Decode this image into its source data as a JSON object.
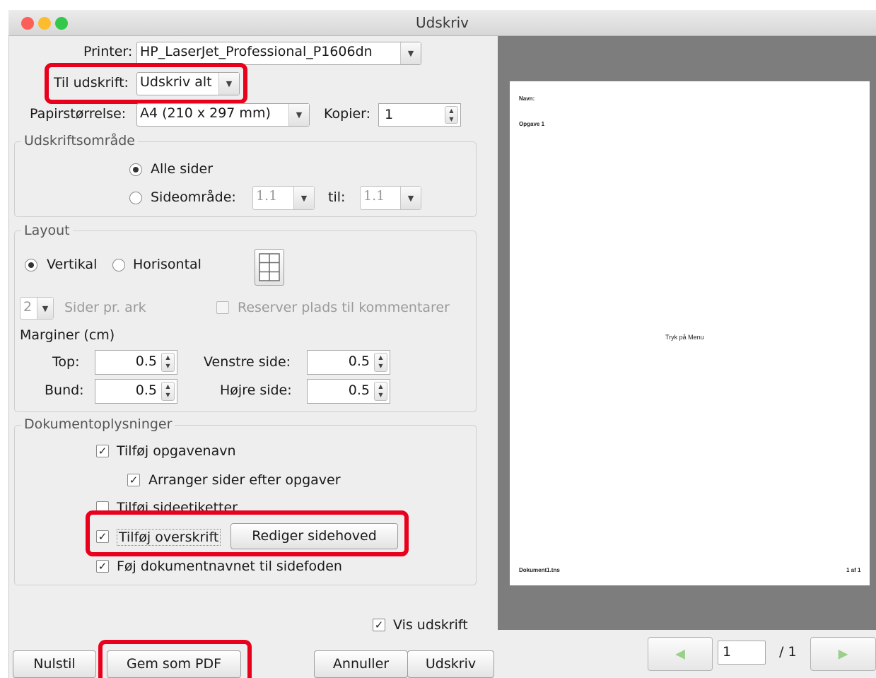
{
  "window": {
    "title": "Udskriv"
  },
  "printer": {
    "label": "Printer:",
    "value": "HP_LaserJet_Professional_P1606dn"
  },
  "til_udskrift": {
    "label": "Til udskrift:",
    "value": "Udskriv alt"
  },
  "paper": {
    "label": "Papirstørrelse:",
    "value": "A4 (210 x 297 mm)"
  },
  "copies": {
    "label": "Kopier:",
    "value": "1"
  },
  "print_range": {
    "title": "Udskriftsområde",
    "all_pages": "Alle sider",
    "page_range": "Sideområde:",
    "from": "1.1",
    "to_label": "til:",
    "to": "1.1"
  },
  "layout": {
    "title": "Layout",
    "portrait": "Vertikal",
    "landscape": "Horisontal",
    "pages_per_sheet": "2",
    "pages_per_sheet_label": "Sider pr. ark",
    "reserve_label": "Reserver plads til kommentarer",
    "margins_label": "Marginer (cm)",
    "top_label": "Top:",
    "top": "0.5",
    "bottom_label": "Bund:",
    "bottom": "0.5",
    "left_label": "Venstre side:",
    "left": "0.5",
    "right_label": "Højre side:",
    "right": "0.5"
  },
  "doc_info": {
    "title": "Dokumentoplysninger",
    "add_task_name": "Tilføj opgavenavn",
    "arrange": "Arranger sider efter opgaver",
    "add_page_labels": "Tilføj sideetiketter",
    "add_header": "Tilføj overskrift",
    "edit_header": "Rediger sidehoved",
    "add_doc_name": "Føj dokumentnavnet til sidefoden"
  },
  "show_print": "Vis udskrift",
  "buttons": {
    "reset": "Nulstil",
    "save_pdf": "Gem som PDF",
    "cancel": "Annuller",
    "print": "Udskriv"
  },
  "preview": {
    "name": "Navn:",
    "task": "Opgave 1",
    "center": "Tryk på Menu",
    "footer_left": "Dokument1.tns",
    "footer_right": "1 af 1",
    "page_value": "1",
    "page_total": "/ 1"
  }
}
